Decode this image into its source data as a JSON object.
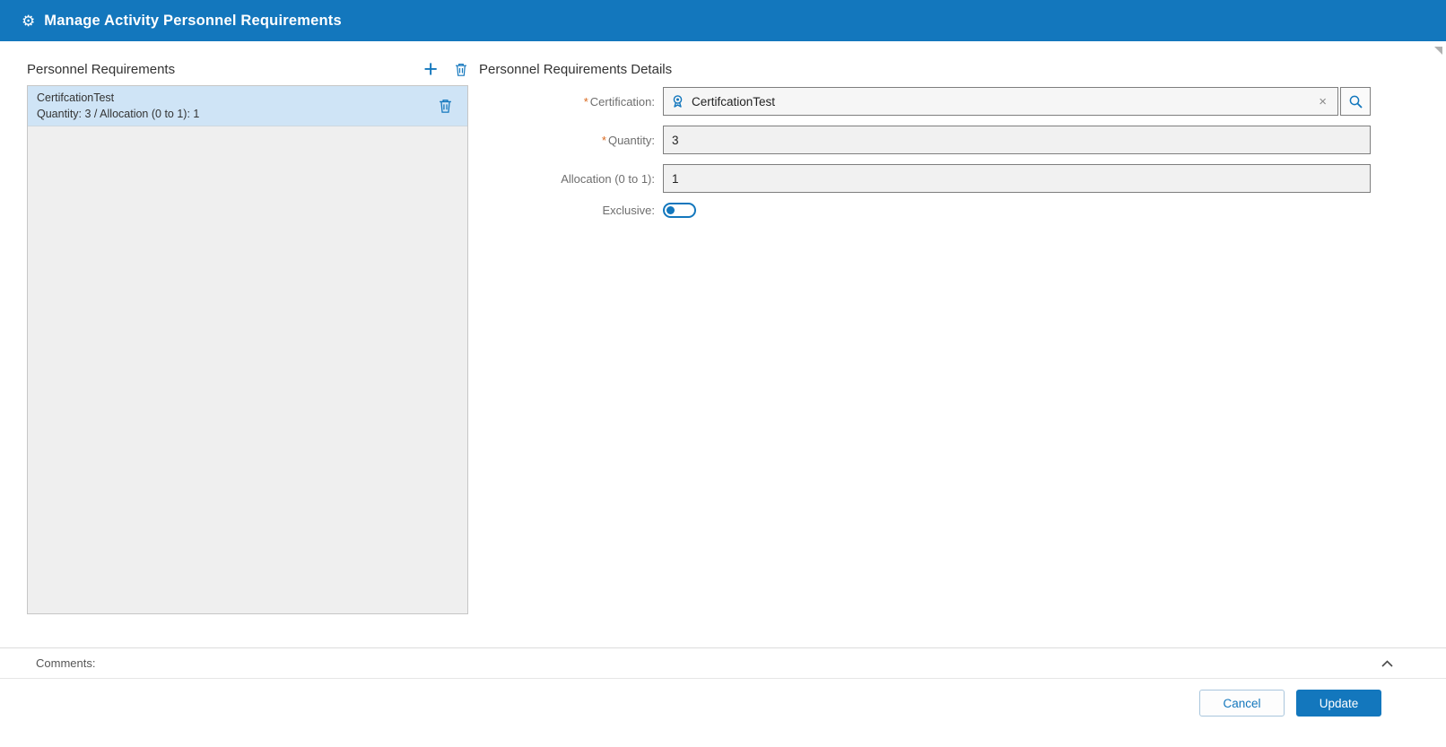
{
  "window": {
    "title": "Manage Activity Personnel Requirements"
  },
  "icons": {
    "gear": "⚙",
    "add": "+",
    "clear": "×"
  },
  "symbols": {
    "required": "*"
  },
  "left_panel": {
    "title": "Personnel Requirements",
    "items": [
      {
        "name": "CertifcationTest",
        "details": "Quantity: 3 /  Allocation (0 to 1): 1",
        "selected": true
      }
    ]
  },
  "details_panel": {
    "title": "Personnel Requirements Details",
    "certification": {
      "label": "Certification:",
      "required": true,
      "value": "CertifcationTest"
    },
    "quantity": {
      "label": "Quantity:",
      "required": true,
      "value": "3"
    },
    "allocation": {
      "label": "Allocation (0 to 1):",
      "required": false,
      "value": "1"
    },
    "exclusive": {
      "label": "Exclusive:",
      "state": "off"
    }
  },
  "footer": {
    "comments_label": "Comments:",
    "cancel_label": "Cancel",
    "update_label": "Update"
  },
  "colors": {
    "titlebar": "#1377bd",
    "accent": "#1377bd",
    "selected_item": "#cfe4f6",
    "required_marker": "#d9681e"
  }
}
